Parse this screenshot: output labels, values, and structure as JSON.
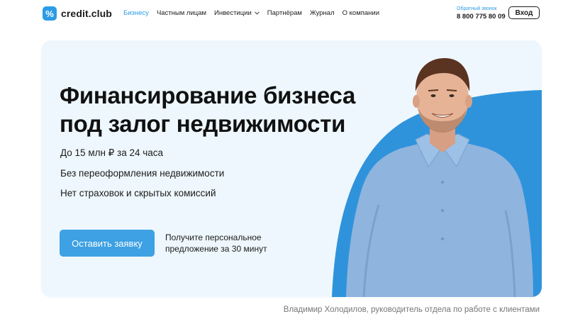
{
  "header": {
    "logo_mark": "%",
    "logo_text": "credit.club",
    "nav": [
      {
        "label": "Бизнесу",
        "active": true
      },
      {
        "label": "Частным лицам"
      },
      {
        "label": "Инвестиции",
        "dropdown": true
      },
      {
        "label": "Партнёрам"
      },
      {
        "label": "Журнал"
      },
      {
        "label": "О компании"
      }
    ],
    "callback_label": "Обратный звонок",
    "phone": "8 800 775 80 09",
    "login_label": "Вход"
  },
  "hero": {
    "title": "Финансирование бизнеса под залог недвижимости",
    "benefits": [
      "До 15 млн ₽ за 24 часа",
      "Без переоформления недвижимости",
      "Нет страховок и скрытых комиссий"
    ],
    "cta_label": "Оставить заявку",
    "cta_note": "Получите персональное предложение за 30 минут"
  },
  "caption": "Владимир Холодилов, руководитель отдела по работе с клиентами",
  "colors": {
    "accent": "#2d9be6",
    "hero_bg": "#eef7fd",
    "button": "#3da1e3",
    "shirt": "#8fb4dd"
  },
  "icons": {
    "logo": "percent-logo-icon",
    "dropdown": "chevron-down-icon"
  }
}
